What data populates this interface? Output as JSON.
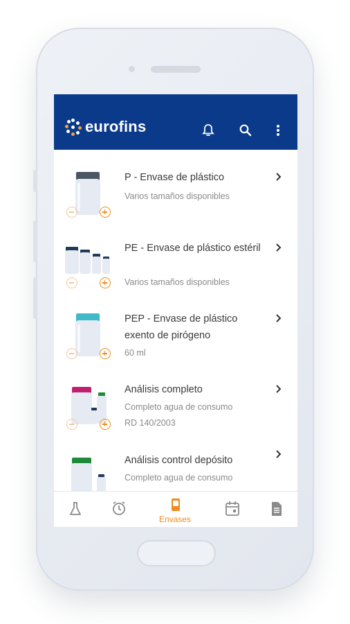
{
  "app": {
    "brand": "eurofins",
    "brand_color": "#0b3a8a",
    "accent_color": "#f08a1c"
  },
  "appbar": {
    "icons": [
      "bell-icon",
      "search-icon",
      "more-vert-icon"
    ]
  },
  "items": [
    {
      "title": "P - Envase de plástico",
      "subtitle": "Varios tamaños disponibles",
      "cap_color": "#4b5563"
    },
    {
      "title": "PE - Envase de plástico estéril",
      "subtitle": "Varios tamaños disponibles",
      "cap_color": "#1f3b5c"
    },
    {
      "title": "PEP - Envase de plástico exento de pirógeno",
      "subtitle": "60 ml",
      "cap_color": "#3fb8c8"
    },
    {
      "title": "Análisis completo",
      "subtitle": "Completo agua de consumo",
      "subtitle2": "RD 140/2003",
      "cap_color": "#c21e6e"
    },
    {
      "title": "Análisis control depósito",
      "subtitle": "Completo agua de consumo",
      "cap_color": "#1f8a3a"
    }
  ],
  "bottom_nav": {
    "active_label": "Envases",
    "items": [
      "flask-icon",
      "alarm-icon",
      "container-icon",
      "calendar-icon",
      "document-icon"
    ]
  }
}
